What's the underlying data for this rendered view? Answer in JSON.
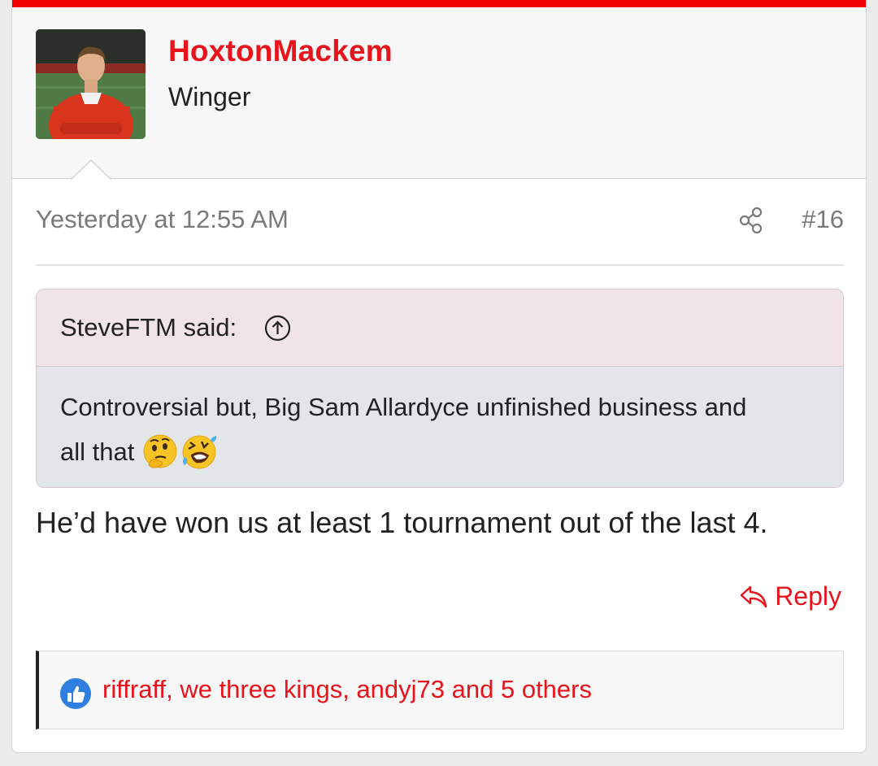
{
  "colors": {
    "accent": "#e8141c",
    "top_bar": "#f00000",
    "quote_header_bg": "#f1e4e6",
    "quote_body_bg": "#e2e6e9",
    "muted_text": "#7a7a7a"
  },
  "user": {
    "name": "HoxtonMackem",
    "title": "Winger",
    "avatar_icon": "user-avatar-photo"
  },
  "post": {
    "date": "Yesterday at 12:55 AM",
    "number": "#16",
    "share_icon": "share-icon",
    "message": "He’d have won us at least 1 tournament out of the last 4."
  },
  "quote": {
    "author_label": "SteveFTM said:",
    "jump_icon": "arrow-up-circle-icon",
    "line1": "Controversial but, Big Sam Allardyce unfinished business and",
    "line2": "all that",
    "emojis": [
      "thinking-face-emoji",
      "rolling-laughing-emoji"
    ]
  },
  "actions": {
    "reply_label": "Reply",
    "reply_icon": "reply-arrow-icon"
  },
  "reactions": {
    "icon": "like-thumb-icon",
    "text": "riffraff, we three kings, andyj73 and 5 others"
  }
}
